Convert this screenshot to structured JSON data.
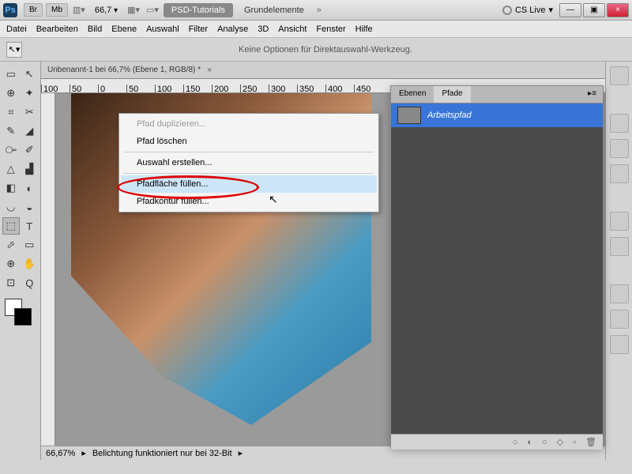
{
  "titlebar": {
    "logo": "Ps",
    "btns": [
      "Br",
      "Mb"
    ],
    "zoom": "66,7",
    "tabs": [
      "PSD-Tutorials",
      "Grundelemente"
    ],
    "chevrons": "»",
    "cslive": "CS Live",
    "window_btns": {
      "min": "—",
      "max": "▣",
      "close": "×"
    }
  },
  "menubar": [
    "Datei",
    "Bearbeiten",
    "Bild",
    "Ebene",
    "Auswahl",
    "Filter",
    "Analyse",
    "3D",
    "Ansicht",
    "Fenster",
    "Hilfe"
  ],
  "optbar": {
    "message": "Keine Optionen für Direktauswahl-Werkzeug."
  },
  "doc": {
    "title": "Unbenannt-1 bei 66,7% (Ebene 1, RGB/8) *",
    "close": "×",
    "ruler_ticks": [
      "100",
      "50",
      "0",
      "50",
      "100",
      "150",
      "200",
      "250",
      "300",
      "350",
      "400",
      "450"
    ]
  },
  "status": {
    "zoom": "66,67%",
    "msg": "Belichtung funktioniert nur bei 32-Bit"
  },
  "panel": {
    "tabs": [
      "Ebenen",
      "Pfade"
    ],
    "menu": "▸≡",
    "item": "Arbeitspfad",
    "foot_icons": [
      "○",
      "◐",
      "○",
      "◇",
      "▫",
      "🗑"
    ]
  },
  "context_menu": {
    "items": [
      {
        "label": "Pfad duplizieren...",
        "disabled": true
      },
      {
        "label": "Pfad löschen"
      },
      {
        "sep": true
      },
      {
        "label": "Auswahl erstellen..."
      },
      {
        "sep": true
      },
      {
        "label": "Pfadfläche füllen...",
        "highlight": true
      },
      {
        "label": "Pfadkontur füllen..."
      }
    ]
  },
  "tools": [
    [
      "▭",
      "↖"
    ],
    [
      "⊕",
      "✦"
    ],
    [
      "⌗",
      "✂"
    ],
    [
      "✎",
      "◢"
    ],
    [
      "⧃",
      "✐"
    ],
    [
      "△",
      "▟"
    ],
    [
      "◧",
      "◐"
    ],
    [
      "◡",
      "◒"
    ],
    [
      "⬚",
      "T"
    ],
    [
      "⬀",
      "▭"
    ],
    [
      "⊕",
      "✋"
    ],
    [
      "⊡",
      "Q"
    ]
  ]
}
